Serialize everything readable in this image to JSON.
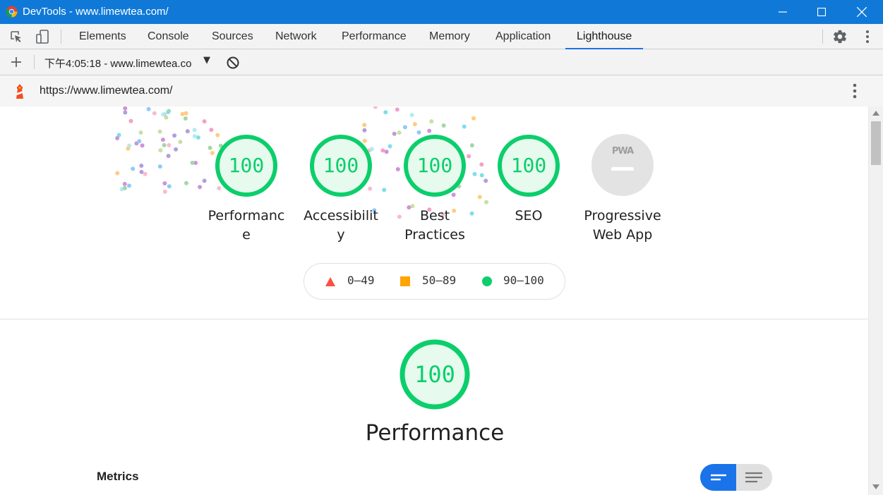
{
  "window": {
    "title": "DevTools - www.limewtea.com/"
  },
  "tabs": [
    {
      "label": "Elements"
    },
    {
      "label": "Console"
    },
    {
      "label": "Sources"
    },
    {
      "label": "Network"
    },
    {
      "label": "Performance"
    },
    {
      "label": "Memory"
    },
    {
      "label": "Application"
    },
    {
      "label": "Lighthouse",
      "active": true
    }
  ],
  "report_toolbar": {
    "report_select": "下午4:05:18 - www.limewtea.co",
    "arrow": "▼"
  },
  "url_bar": {
    "url": "https://www.limewtea.com/"
  },
  "categories": [
    {
      "score": "100",
      "label": "Performance"
    },
    {
      "score": "100",
      "label": "Accessibility"
    },
    {
      "score": "100",
      "label": "Best Practices"
    },
    {
      "score": "100",
      "label": "SEO"
    },
    {
      "score": "",
      "label": "Progressive Web App",
      "badge": "PWA"
    }
  ],
  "legend": [
    {
      "label": "0–49",
      "color": "#ff4e42",
      "shape": "triangle"
    },
    {
      "label": "50–89",
      "color": "#ffa400",
      "shape": "square"
    },
    {
      "label": "90–100",
      "color": "#0cce6b",
      "shape": "circle"
    }
  ],
  "performance_section": {
    "score": "100",
    "title": "Performance",
    "metrics_heading": "Metrics"
  },
  "colors": {
    "titlebar": "#1079d8",
    "pass": "#0cce6b",
    "accent": "#1a73e8"
  }
}
